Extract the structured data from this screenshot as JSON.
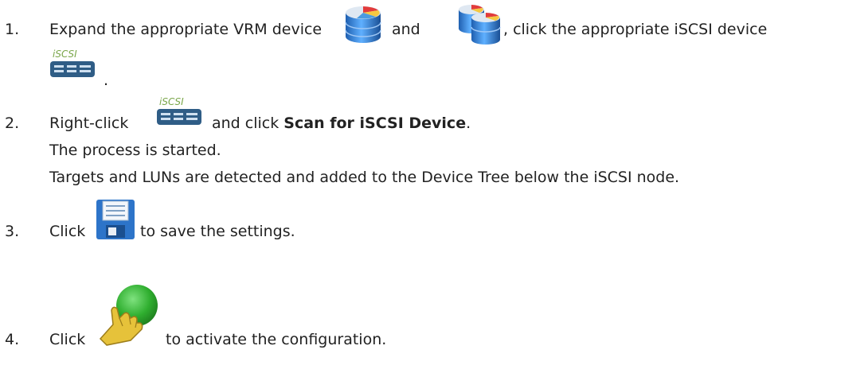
{
  "steps": [
    {
      "number": "1.",
      "text_a": "Expand the appropriate VRM device",
      "text_b": "and",
      "text_c": ", click the appropriate iSCSI device",
      "text_d": ".",
      "icons": [
        "vrm-device-icon",
        "vrm-secondary-device-icon",
        "iscsi-device-icon"
      ]
    },
    {
      "number": "2.",
      "text_a": "Right-click",
      "text_b": "and click",
      "bold": "Scan for iSCSI Device",
      "text_c": ".",
      "line2": "The process is started.",
      "line3": "Targets and LUNs are detected and added to the Device Tree below the iSCSI node.",
      "icons": [
        "iscsi-device-icon"
      ]
    },
    {
      "number": "3.",
      "text_a": "Click",
      "text_b": "to save the settings.",
      "icons": [
        "save-icon"
      ]
    },
    {
      "number": "4.",
      "text_a": "Click",
      "text_b": "to activate the configuration.",
      "icons": [
        "activate-configuration-icon"
      ]
    }
  ],
  "icon_label": "iSCSI",
  "colors": {
    "text": "#222222",
    "iscsi_label": "#7aa64a",
    "device_body": "#2f5d86",
    "db_blue": "#2f7fd6",
    "save_blue": "#2d74c9",
    "activate_green": "#2fae2f",
    "hand_yellow": "#e6c23a"
  }
}
